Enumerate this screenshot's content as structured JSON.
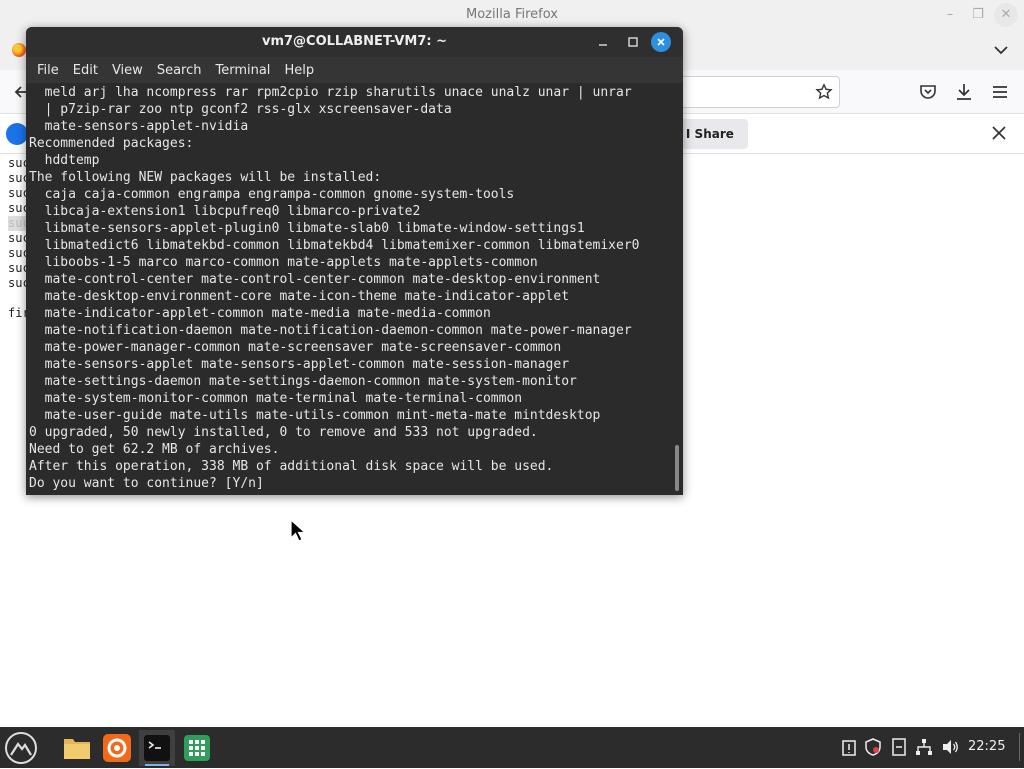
{
  "firefox": {
    "window_title": "Mozilla Firefox",
    "notification_button_label": "t I Share",
    "page_lines": [
      "suc",
      "suc",
      "suc",
      "suc",
      "suc",
      "suc",
      "suc",
      "suc",
      "suc",
      "",
      "fir"
    ],
    "icons": [
      "back-arrow-icon",
      "bookmark-star-icon",
      "pocket-icon",
      "download-icon",
      "hamburger-menu-icon",
      "close-icon",
      "chevron-down-icon"
    ]
  },
  "terminal": {
    "title": "vm7@COLLABNET-VM7: ~",
    "menu": [
      "File",
      "Edit",
      "View",
      "Search",
      "Terminal",
      "Help"
    ],
    "lines": [
      "  meld arj lha ncompress rar rpm2cpio rzip sharutils unace unalz unar | unrar",
      "  | p7zip-rar zoo ntp gconf2 rss-glx xscreensaver-data",
      "  mate-sensors-applet-nvidia",
      "Recommended packages:",
      "  hddtemp",
      "The following NEW packages will be installed:",
      "  caja caja-common engrampa engrampa-common gnome-system-tools",
      "  libcaja-extension1 libcpufreq0 libmarco-private2",
      "  libmate-sensors-applet-plugin0 libmate-slab0 libmate-window-settings1",
      "  libmatedict6 libmatekbd-common libmatekbd4 libmatemixer-common libmatemixer0",
      "  liboobs-1-5 marco marco-common mate-applets mate-applets-common",
      "  mate-control-center mate-control-center-common mate-desktop-environment",
      "  mate-desktop-environment-core mate-icon-theme mate-indicator-applet",
      "  mate-indicator-applet-common mate-media mate-media-common",
      "  mate-notification-daemon mate-notification-daemon-common mate-power-manager",
      "  mate-power-manager-common mate-screensaver mate-screensaver-common",
      "  mate-sensors-applet mate-sensors-applet-common mate-session-manager",
      "  mate-settings-daemon mate-settings-daemon-common mate-system-monitor",
      "  mate-system-monitor-common mate-terminal mate-terminal-common",
      "  mate-user-guide mate-utils mate-utils-common mint-meta-mate mintdesktop",
      "0 upgraded, 50 newly installed, 0 to remove and 533 not upgraded.",
      "Need to get 62.2 MB of archives.",
      "After this operation, 338 MB of additional disk space will be used.",
      "Do you want to continue? [Y/n]"
    ]
  },
  "taskbar": {
    "clock": "22:25",
    "apps": [
      "files-app",
      "firefox-app",
      "terminal-app",
      "spreadsheet-app"
    ],
    "active_app": "terminal-app",
    "accent_color": "#7fb2e8"
  }
}
